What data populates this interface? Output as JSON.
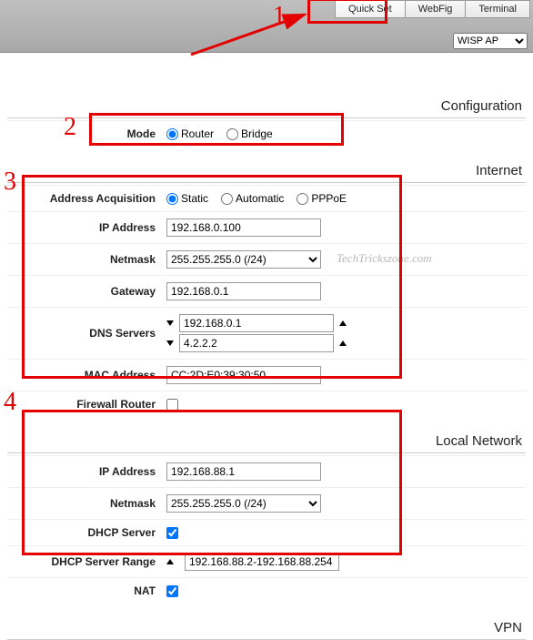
{
  "tabs": {
    "quickset": "Quick Set",
    "webfig": "WebFig",
    "terminal": "Terminal"
  },
  "wisp_option": "WISP AP",
  "sections": {
    "configuration": "Configuration",
    "internet": "Internet",
    "localnet": "Local Network",
    "vpn": "VPN"
  },
  "labels": {
    "mode": "Mode",
    "addr_acq": "Address Acquisition",
    "ip": "IP Address",
    "netmask": "Netmask",
    "gateway": "Gateway",
    "dns": "DNS Servers",
    "mac": "MAC Address",
    "firewall": "Firewall Router",
    "dhcp_server": "DHCP Server",
    "dhcp_range": "DHCP Server Range",
    "nat": "NAT"
  },
  "mode": {
    "router": "Router",
    "bridge": "Bridge"
  },
  "acq": {
    "static": "Static",
    "automatic": "Automatic",
    "pppoe": "PPPoE"
  },
  "internet": {
    "ip": "192.168.0.100",
    "netmask": "255.255.255.0 (/24)",
    "gateway": "192.168.0.1",
    "dns1": "192.168.0.1",
    "dns2": "4.2.2.2",
    "mac": "CC:2D:E0:39:30:50"
  },
  "local": {
    "ip": "192.168.88.1",
    "netmask": "255.255.255.0 (/24)",
    "range": "192.168.88.2-192.168.88.254"
  },
  "watermark": "TechTrickszone.com",
  "anno": {
    "n1": "1",
    "n2": "2",
    "n3": "3",
    "n4": "4"
  }
}
